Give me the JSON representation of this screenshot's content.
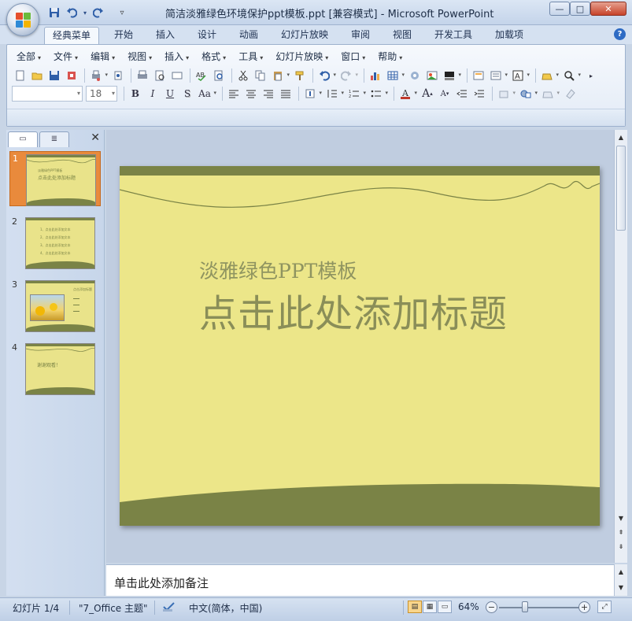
{
  "window": {
    "title": "简洁淡雅绿色环境保护ppt模板.ppt [兼容模式] - Microsoft PowerPoint",
    "controls": {
      "minimize": "—",
      "maximize": "□",
      "close": "✕"
    }
  },
  "quick_access": {
    "save_icon": "floppy-disk",
    "undo_icon": "undo-arrow",
    "redo_icon": "redo-arrow",
    "customize": "▿"
  },
  "tabs": [
    "经典菜单",
    "开始",
    "插入",
    "设计",
    "动画",
    "幻灯片放映",
    "审阅",
    "视图",
    "开发工具",
    "加载项"
  ],
  "active_tab": "经典菜单",
  "help": "?",
  "menu": [
    "全部",
    "文件",
    "编辑",
    "视图",
    "插入",
    "格式",
    "工具",
    "幻灯片放映",
    "窗口",
    "帮助"
  ],
  "font": {
    "name": "",
    "size": "18"
  },
  "format_buttons": {
    "bold": "B",
    "italic": "I",
    "underline": "U",
    "shadow": "S",
    "change_case": "Aa",
    "font_color": "A"
  },
  "panel": {
    "close": "✕"
  },
  "thumbnails": [
    {
      "number": "1",
      "caption_small": "淡雅绿色PPT模板",
      "caption": "点击此处添加标题",
      "selected": true
    },
    {
      "number": "2",
      "lines": [
        "1、点击此处添加文本",
        "2、点击此处添加文本",
        "3、点击此处添加文本",
        "4、点击此处添加文本"
      ]
    },
    {
      "number": "3",
      "caption": "点击添加标题"
    },
    {
      "number": "4",
      "caption": "谢谢观看！"
    }
  ],
  "slide": {
    "subtitle": "淡雅绿色PPT模板",
    "title": "点击此处添加标题",
    "colors": {
      "background": "#ece689",
      "band": "#7a8346",
      "text": "#8a8e58"
    }
  },
  "notes": {
    "placeholder": "单击此处添加备注"
  },
  "status": {
    "slide_counter": "幻灯片 1/4",
    "theme": "\"7_Office 主题\"",
    "language": "中文(简体，中国)",
    "zoom": "64%",
    "zoom_out": "−",
    "zoom_in": "+",
    "zoom_level": 0.32
  }
}
